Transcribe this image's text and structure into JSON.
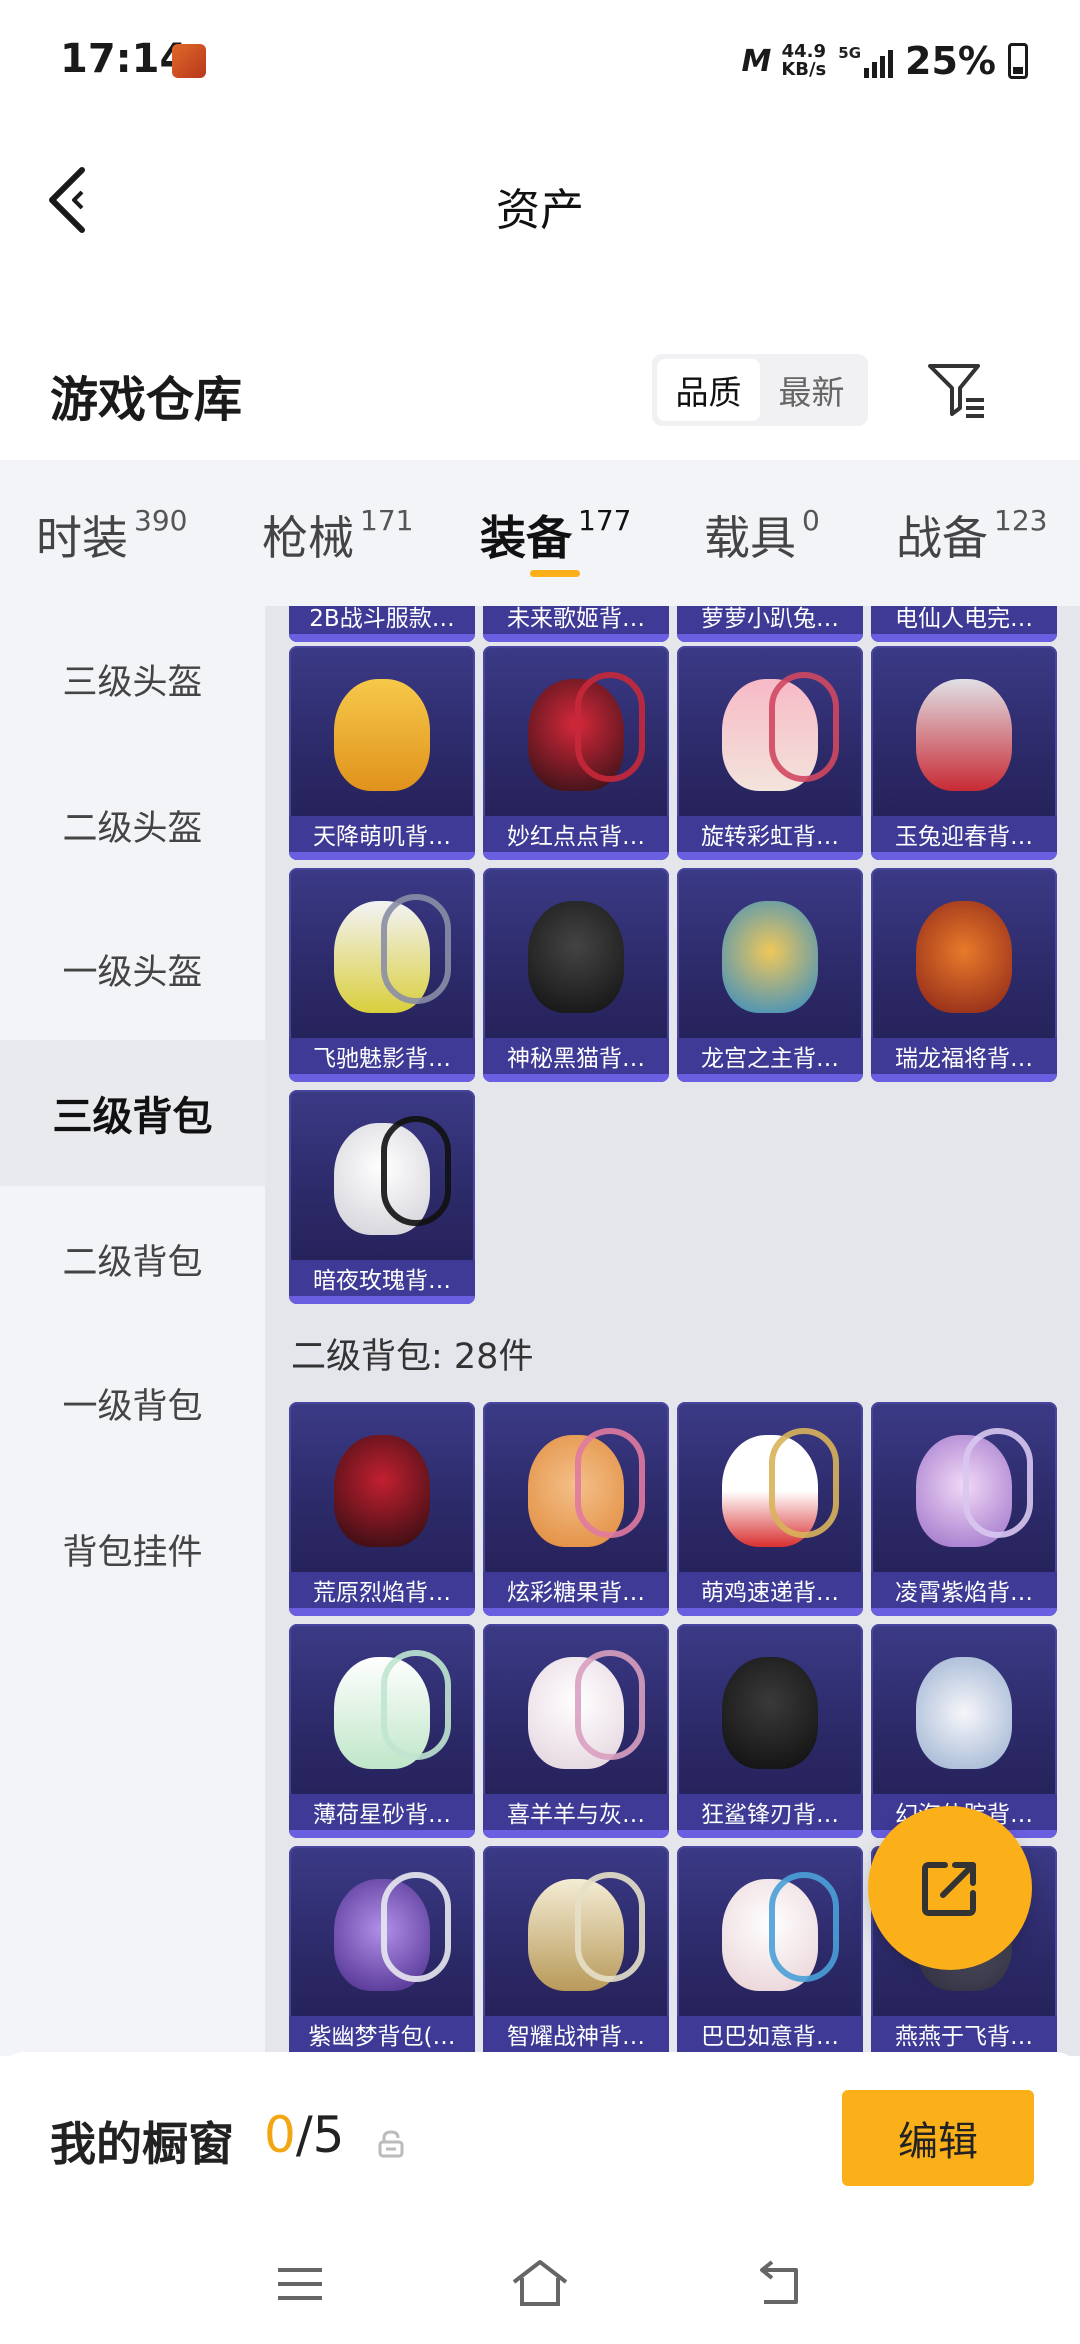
{
  "status": {
    "time": "17:14",
    "net_logo": "M",
    "net_speed_value": "44.9",
    "net_speed_unit": "KB/s",
    "network_type": "5G",
    "battery": "25%"
  },
  "header": {
    "title": "资产"
  },
  "warehouse": {
    "title": "游戏仓库",
    "sort_options": [
      "品质",
      "最新"
    ],
    "sort_selected": "品质"
  },
  "tabs": [
    {
      "label": "时装",
      "count": "390"
    },
    {
      "label": "枪械",
      "count": "171"
    },
    {
      "label": "装备",
      "count": "177"
    },
    {
      "label": "载具",
      "count": "0"
    },
    {
      "label": "战备",
      "count": "123"
    }
  ],
  "active_tab": "装备",
  "sidebar": {
    "items": [
      "三级头盔",
      "二级头盔",
      "一级头盔",
      "三级背包",
      "二级背包",
      "一级背包",
      "背包挂件"
    ],
    "active": "三级背包"
  },
  "partial_row": [
    "2B战斗服款…",
    "未来歌姬背…",
    "萝萝小趴兔…",
    "电仙人电完…"
  ],
  "level3_items": [
    "天降萌叽背…",
    "妙红点点背…",
    "旋转彩虹背…",
    "玉兔迎春背…",
    "飞驰魅影背…",
    "神秘黑猫背…",
    "龙宫之主背…",
    "瑞龙福将背…",
    "暗夜玫瑰背…"
  ],
  "level2_section": {
    "header": "二级背包: 28件",
    "items": [
      "荒原烈焰背…",
      "炫彩糖果背…",
      "萌鸡速递背…",
      "凌霄紫焰背…",
      "薄荷星砂背…",
      "喜羊羊与灰…",
      "狂鲨锋刃背…",
      "幻海仙踪背…",
      "紫幽梦背包(…",
      "智耀战神背…",
      "巴巴如意背…",
      "燕燕于飞背…"
    ]
  },
  "showcase": {
    "label": "我的橱窗",
    "current": "0",
    "total": "/5",
    "edit_label": "编辑"
  },
  "colors": {
    "accent": "#fbb01a",
    "card_bg": "#2b2866",
    "card_label_bg": "#3e3a96"
  }
}
